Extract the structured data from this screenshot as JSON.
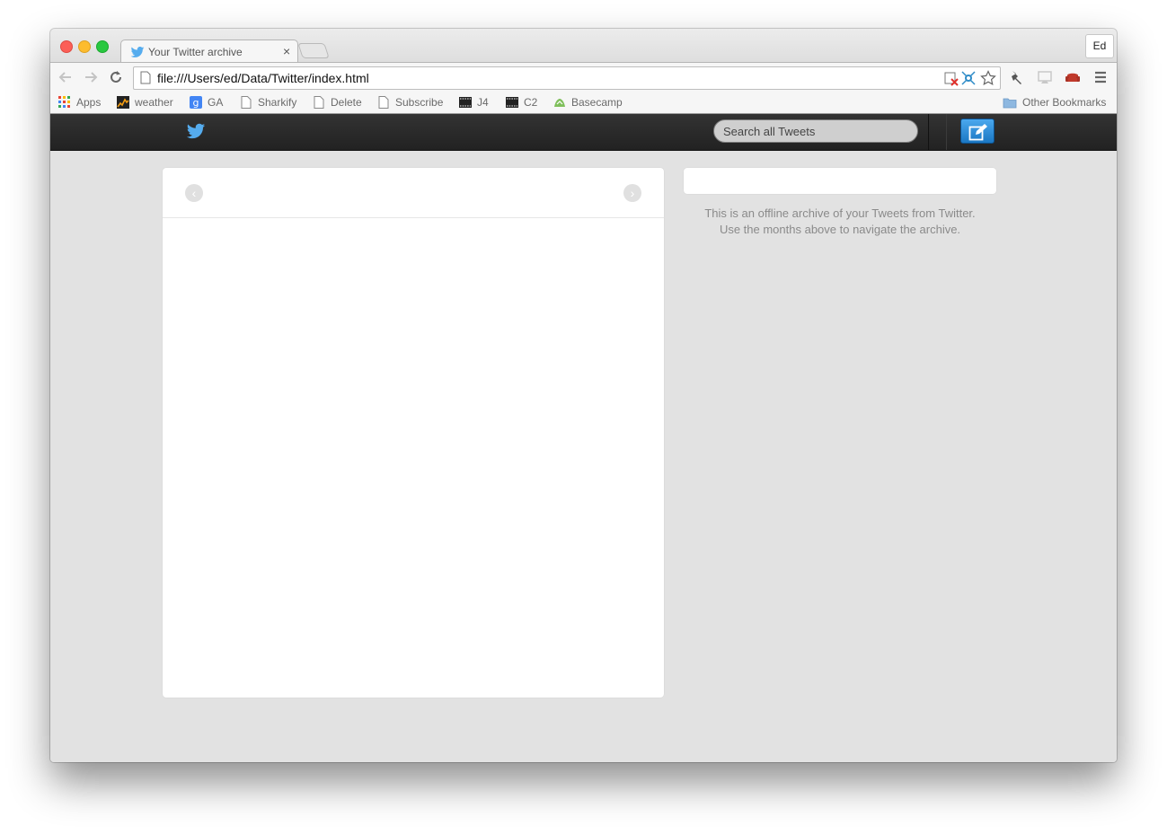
{
  "browser": {
    "tab": {
      "title": "Your Twitter archive",
      "close_glyph": "×"
    },
    "profile_label": "Ed",
    "url": "file:///Users/ed/Data/Twitter/index.html",
    "bookmarks": [
      {
        "label": "Apps",
        "icon": "apps-grid-icon"
      },
      {
        "label": "weather",
        "icon": "weather-icon"
      },
      {
        "label": "GA",
        "icon": "google-analytics-icon"
      },
      {
        "label": "Sharkify",
        "icon": "page-icon"
      },
      {
        "label": "Delete",
        "icon": "page-icon"
      },
      {
        "label": "Subscribe",
        "icon": "page-icon"
      },
      {
        "label": "J4",
        "icon": "film-icon"
      },
      {
        "label": "C2",
        "icon": "film-icon"
      },
      {
        "label": "Basecamp",
        "icon": "basecamp-icon"
      }
    ],
    "other_bookmarks": "Other Bookmarks"
  },
  "twitter": {
    "search_placeholder": "Search all Tweets",
    "prev_glyph": "‹",
    "next_glyph": "›",
    "info_line1": "This is an offline archive of your Tweets from Twitter.",
    "info_line2": "Use the months above to navigate the archive."
  },
  "colors": {
    "twitter_blue": "#55acee",
    "topbar": "#2a2a2a",
    "compose_blue": "#2a8ad8"
  }
}
